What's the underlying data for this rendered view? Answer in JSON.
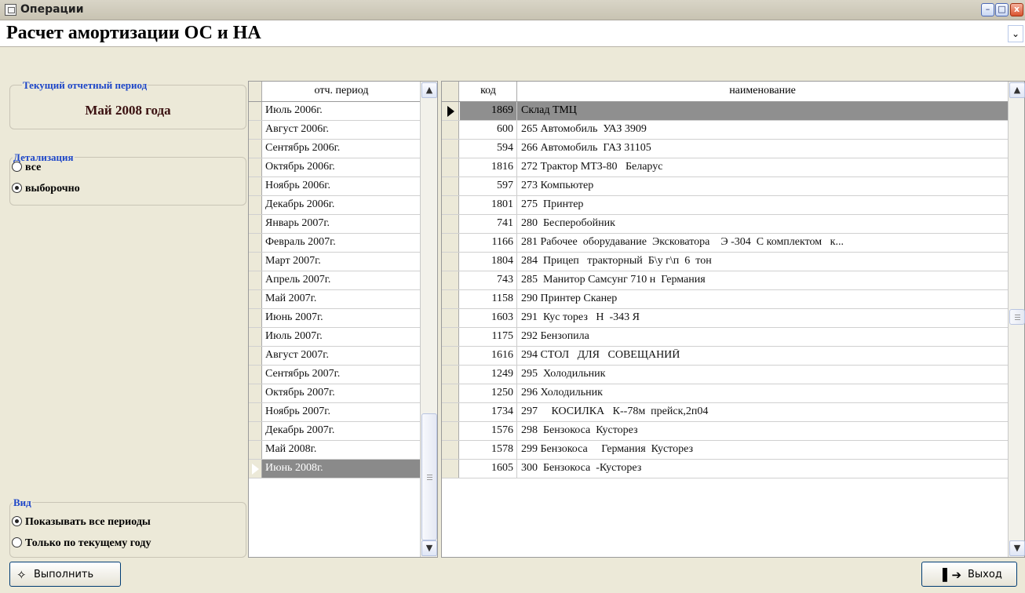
{
  "window": {
    "title": "Операции",
    "min_label": "–",
    "max_label": "□",
    "close_label": "x"
  },
  "header": {
    "title": "Расчет амортизации ОС и НА",
    "dropdown_icon": "⌄"
  },
  "current_period": {
    "label": "Текущий отчетный период",
    "value": "Май 2008 года"
  },
  "detail": {
    "label": "Детализация",
    "options": [
      {
        "label": "все",
        "selected": false
      },
      {
        "label": "выборочно",
        "selected": true
      }
    ]
  },
  "view": {
    "label": "Вид",
    "options": [
      {
        "label": "Показывать все периоды",
        "selected": true
      },
      {
        "label": "Только по текущему году",
        "selected": false
      }
    ]
  },
  "periods": {
    "header": "отч. период",
    "rows": [
      "Июль 2006г.",
      "Август 2006г.",
      "Сентябрь 2006г.",
      "Октябрь 2006г.",
      "Ноябрь 2006г.",
      "Декабрь 2006г.",
      "Январь 2007г.",
      "Февраль 2007г.",
      "Март 2007г.",
      "Апрель 2007г.",
      "Май 2007г.",
      "Июнь 2007г.",
      "Июль 2007г.",
      "Август 2007г.",
      "Сентябрь 2007г.",
      "Октябрь 2007г.",
      "Ноябрь 2007г.",
      "Декабрь 2007г.",
      "Май 2008г.",
      "Июнь 2008г."
    ],
    "selected_index": 19
  },
  "assets": {
    "headers": {
      "code": "код",
      "name": "наименование"
    },
    "rows": [
      {
        "code": "1869",
        "name": "Склад ТМЦ"
      },
      {
        "code": "600",
        "name": "265 Автомобиль  УАЗ 3909"
      },
      {
        "code": "594",
        "name": "266 Автомобиль  ГАЗ 31105"
      },
      {
        "code": "1816",
        "name": "272 Трактор МТЗ-80   Беларус"
      },
      {
        "code": "597",
        "name": "273 Компьютер"
      },
      {
        "code": "1801",
        "name": "275  Принтер"
      },
      {
        "code": "741",
        "name": "280  Бесперобойник"
      },
      {
        "code": "1166",
        "name": "281 Рабочее  оборудавание  Эксковатора    Э -304  С комплектом   к..."
      },
      {
        "code": "1804",
        "name": "284  Прицеп   тракторный  Б\\у г\\п  6  тон"
      },
      {
        "code": "743",
        "name": "285  Манитор Самсунг 710 н  Германия"
      },
      {
        "code": "1158",
        "name": "290 Принтер Сканер"
      },
      {
        "code": "1603",
        "name": "291  Кус торез   Н  -343 Я"
      },
      {
        "code": "1175",
        "name": "292 Бензопила"
      },
      {
        "code": "1616",
        "name": "294 СТОЛ   ДЛЯ   СОВЕЩАНИЙ"
      },
      {
        "code": "1249",
        "name": "295  Холодильник"
      },
      {
        "code": "1250",
        "name": "296 Холодильник"
      },
      {
        "code": "1734",
        "name": "297     КОСИЛКА   К--78м  прейск,2п04"
      },
      {
        "code": "1576",
        "name": "298  Бензокоса  Кусторез"
      },
      {
        "code": "1578",
        "name": "299 Бензокоса     Германия  Кусторез"
      },
      {
        "code": "1605",
        "name": "300  Бензокоса  -Кусторез"
      }
    ],
    "selected_index": 0
  },
  "buttons": {
    "run": "Выполнить",
    "exit": "Выход"
  },
  "icons": {
    "app": "app-window-icon",
    "run": "sparkle-icon",
    "exit": "door-exit-icon"
  }
}
